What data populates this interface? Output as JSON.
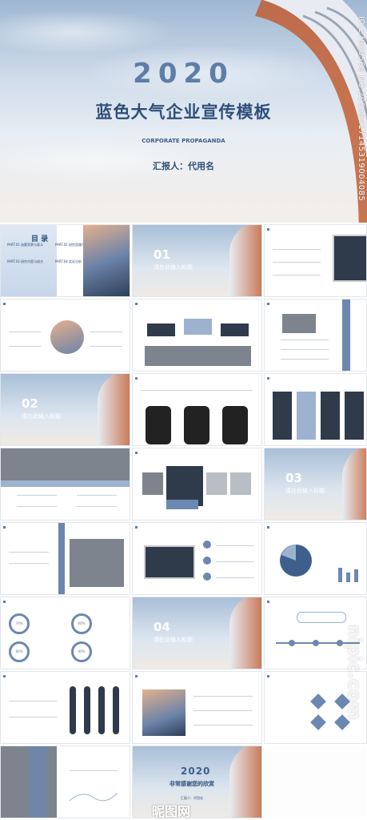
{
  "cover": {
    "year": "2020",
    "title": "蓝色大气企业宣传模板",
    "subtitle": "CORPORATE PROPAGANDA",
    "reporter": "汇报人：代用名",
    "image_id": "ID:27908568 NO:20200417145319004085"
  },
  "slides": {
    "toc": {
      "title": "目 录",
      "items": [
        "PART.01 选题背景与意义",
        "PART.02 研究思路与理论",
        "PART.03 研究内容与成方",
        "PART.04 实证分析"
      ]
    },
    "sec01": {
      "num": "01",
      "label": "请在此输入标题"
    },
    "sec02": {
      "num": "02",
      "label": "请在此输入标题"
    },
    "sec03": {
      "num": "03",
      "label": "请在此输入标题"
    },
    "sec04": {
      "num": "04",
      "label": "请在此输入标题"
    },
    "end": {
      "year": "2020",
      "thanks": "非常感谢您的欣赏",
      "reporter": "汇报人：代用名"
    },
    "pct": [
      "70%",
      "60%",
      "80%",
      "90%"
    ]
  },
  "watermark": {
    "site": "nipic.com",
    "brand": "昵图网"
  }
}
